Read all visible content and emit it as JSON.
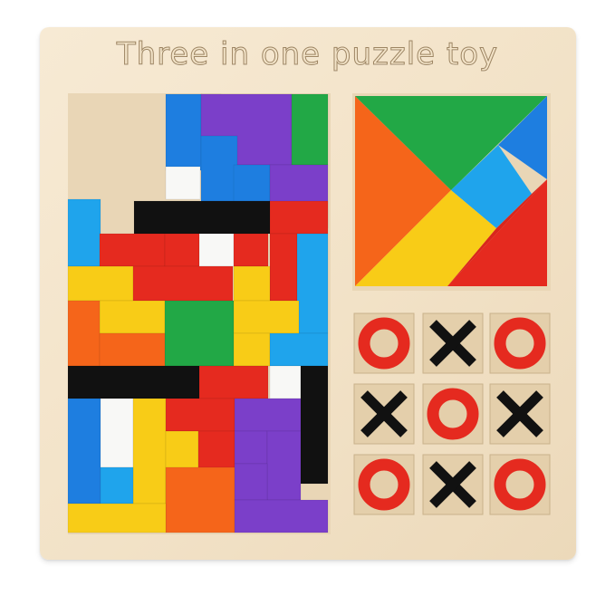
{
  "title": "Three in one puzzle toy",
  "tic_tac_toe": {
    "cells": [
      [
        "O",
        "X",
        "O"
      ],
      [
        "X",
        "O",
        "X"
      ],
      [
        "O",
        "X",
        "O"
      ]
    ]
  },
  "colors": {
    "board": "#f2e2c7",
    "blue": "#1e7ee0",
    "lightblue": "#1fa4ec",
    "purple": "#7b3fc9",
    "green": "#22a846",
    "red": "#e52a1f",
    "orange": "#f5651a",
    "yellow": "#f8cc17",
    "black": "#111111",
    "white": "#f8f8f6"
  }
}
